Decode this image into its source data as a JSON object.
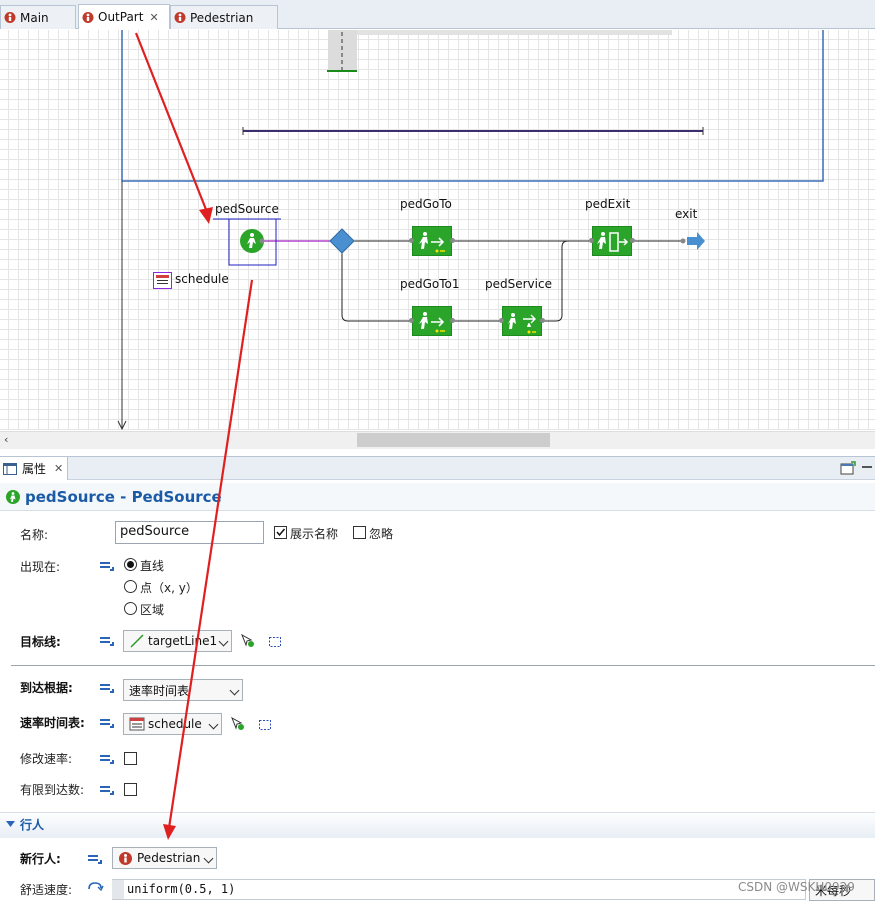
{
  "tabs": [
    {
      "label": "Main",
      "active": false,
      "closable": false
    },
    {
      "label": "OutPart",
      "active": true,
      "closable": true
    },
    {
      "label": "Pedestrian",
      "active": false,
      "closable": false
    }
  ],
  "diagram": {
    "blocks": {
      "source": "pedSource",
      "schedule": "schedule",
      "goto": "pedGoTo",
      "goto1": "pedGoTo1",
      "service": "pedService",
      "exit_block": "pedExit",
      "exit_port": "exit"
    }
  },
  "properties": {
    "panel_tab": "属性",
    "title": "pedSource - PedSource",
    "name_label": "名称:",
    "name_value": "pedSource",
    "show_name_label": "展示名称",
    "show_name_checked": true,
    "ignore_label": "忽略",
    "ignore_checked": false,
    "appear_label": "出现在:",
    "appear_options": [
      "直线",
      "点（x, y）",
      "区域"
    ],
    "appear_selected": 0,
    "target_line_label": "目标线:",
    "target_line_value": "targetLine1",
    "arrival_label": "到达根据:",
    "arrival_value": "速率时间表",
    "rate_schedule_label": "速率时间表:",
    "rate_schedule_value": "schedule",
    "modify_rate_label": "修改速率:",
    "limited_arrivals_label": "有限到达数:",
    "section_label": "行人",
    "new_ped_label": "新行人:",
    "new_ped_value": "Pedestrian",
    "comfort_speed_label": "舒适速度:",
    "comfort_speed_value": "uniform(0.5, 1)",
    "speed_unit": "米每秒",
    "watermark": "CSDN @WSKH0929"
  },
  "colors": {
    "block_green": "#2aa52a",
    "annotation_red": "#e02020",
    "title_blue": "#1a5aa6",
    "frame_blue": "#3a6fb5"
  }
}
